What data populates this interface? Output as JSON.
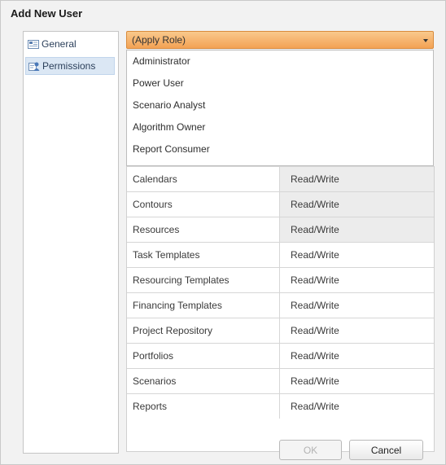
{
  "dialog": {
    "title": "Add New User"
  },
  "nav": {
    "items": [
      {
        "label": "General",
        "icon": "general-icon"
      },
      {
        "label": "Permissions",
        "icon": "permissions-icon",
        "selected": true
      }
    ]
  },
  "role_select": {
    "value": "(Apply Role)",
    "options": [
      "Administrator",
      "Power User",
      "Scenario Analyst",
      "Algorithm Owner",
      "Report Consumer"
    ]
  },
  "permissions": [
    {
      "name": "Calendars",
      "access": "Read/Write"
    },
    {
      "name": "Contours",
      "access": "Read/Write"
    },
    {
      "name": "Resources",
      "access": "Read/Write"
    },
    {
      "name": "Task Templates",
      "access": "Read/Write"
    },
    {
      "name": "Resourcing Templates",
      "access": "Read/Write"
    },
    {
      "name": "Financing Templates",
      "access": "Read/Write"
    },
    {
      "name": "Project Repository",
      "access": "Read/Write"
    },
    {
      "name": "Portfolios",
      "access": "Read/Write"
    },
    {
      "name": "Scenarios",
      "access": "Read/Write"
    },
    {
      "name": "Reports",
      "access": "Read/Write"
    }
  ],
  "buttons": {
    "ok": "OK",
    "cancel": "Cancel"
  },
  "colors": {
    "accent": "#f3a254",
    "selection": "#dbe7f4"
  }
}
